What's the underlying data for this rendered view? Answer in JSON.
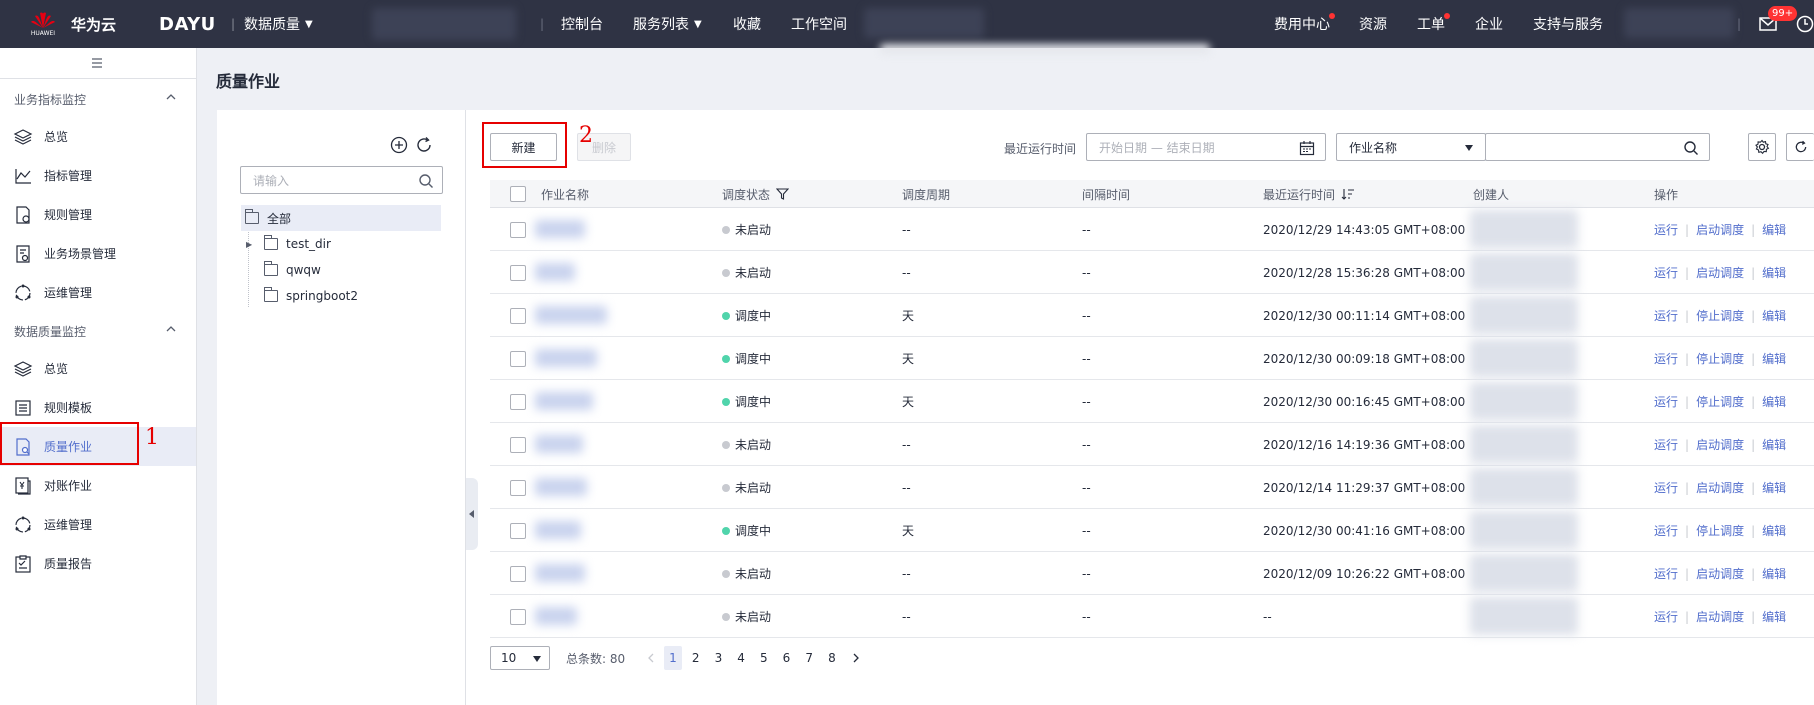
{
  "topbar": {
    "brand_en": "HUAWEI",
    "brand_cn": "华为云",
    "product": "DAYU",
    "module": "数据质量",
    "menu": [
      "控制台",
      "服务列表",
      "收藏",
      "工作空间"
    ],
    "right_menu": [
      "费用中心",
      "资源",
      "工单",
      "企业",
      "支持与服务"
    ],
    "mail_badge": "99+"
  },
  "sidebar": {
    "group1": "业务指标监控",
    "group1_items": [
      "总览",
      "指标管理",
      "规则管理",
      "业务场景管理",
      "运维管理"
    ],
    "group2": "数据质量监控",
    "group2_items": [
      "总览",
      "规则模板",
      "质量作业",
      "对账作业",
      "运维管理",
      "质量报告"
    ]
  },
  "annotations": {
    "n1": "1",
    "n2": "2"
  },
  "page_title": "质量作业",
  "tree": {
    "search_placeholder": "请输入",
    "root": "全部",
    "children": [
      "test_dir",
      "qwqw",
      "springboot2"
    ]
  },
  "toolbar": {
    "new_label": "新建",
    "delete_label": "删除",
    "last_run_label": "最近运行时间",
    "date_placeholder": "开始日期 — 结束日期",
    "filter_select": "作业名称"
  },
  "table": {
    "headers": [
      "作业名称",
      "调度状态",
      "调度周期",
      "间隔时间",
      "最近运行时间",
      "创建人",
      "操作"
    ],
    "rows": [
      {
        "status": "未启动",
        "active": false,
        "period": "--",
        "interval": "--",
        "time": "2020/12/29 14:43:05 GMT+08:00",
        "ops": [
          "运行",
          "启动调度",
          "编辑"
        ]
      },
      {
        "status": "未启动",
        "active": false,
        "period": "--",
        "interval": "--",
        "time": "2020/12/28 15:36:28 GMT+08:00",
        "ops": [
          "运行",
          "启动调度",
          "编辑"
        ]
      },
      {
        "status": "调度中",
        "active": true,
        "period": "天",
        "interval": "--",
        "time": "2020/12/30 00:11:14 GMT+08:00",
        "ops": [
          "运行",
          "停止调度",
          "编辑"
        ]
      },
      {
        "status": "调度中",
        "active": true,
        "period": "天",
        "interval": "--",
        "time": "2020/12/30 00:09:18 GMT+08:00",
        "ops": [
          "运行",
          "停止调度",
          "编辑"
        ]
      },
      {
        "status": "调度中",
        "active": true,
        "period": "天",
        "interval": "--",
        "time": "2020/12/30 00:16:45 GMT+08:00",
        "ops": [
          "运行",
          "停止调度",
          "编辑"
        ]
      },
      {
        "status": "未启动",
        "active": false,
        "period": "--",
        "interval": "--",
        "time": "2020/12/16 14:19:36 GMT+08:00",
        "ops": [
          "运行",
          "启动调度",
          "编辑"
        ]
      },
      {
        "status": "未启动",
        "active": false,
        "period": "--",
        "interval": "--",
        "time": "2020/12/14 11:29:37 GMT+08:00",
        "ops": [
          "运行",
          "启动调度",
          "编辑"
        ]
      },
      {
        "status": "调度中",
        "active": true,
        "period": "天",
        "interval": "--",
        "time": "2020/12/30 00:41:16 GMT+08:00",
        "ops": [
          "运行",
          "停止调度",
          "编辑"
        ]
      },
      {
        "status": "未启动",
        "active": false,
        "period": "--",
        "interval": "--",
        "time": "2020/12/09 10:26:22 GMT+08:00",
        "ops": [
          "运行",
          "启动调度",
          "编辑"
        ]
      },
      {
        "status": "未启动",
        "active": false,
        "period": "--",
        "interval": "--",
        "time": "--",
        "ops": [
          "运行",
          "启动调度",
          "编辑"
        ]
      }
    ]
  },
  "pagination": {
    "page_size": "10",
    "total": "总条数: 80",
    "pages": [
      "1",
      "2",
      "3",
      "4",
      "5",
      "6",
      "7",
      "8"
    ],
    "current": "1"
  },
  "colors": {
    "active": "#50d4ab",
    "inactive": "#c8cad0",
    "link": "#526ecc",
    "highlight": "#e60000"
  }
}
